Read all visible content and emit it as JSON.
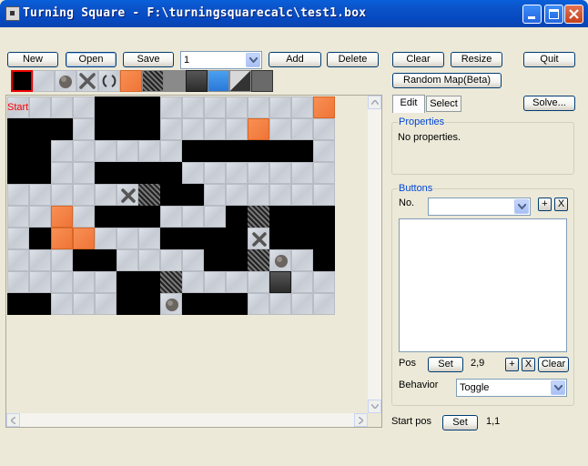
{
  "window": {
    "title": "Turning Square - F:\\turningsquarecalc\\test1.box"
  },
  "toolbar": {
    "new_label": "New",
    "open_label": "Open",
    "save_label": "Save",
    "map_select_value": "1",
    "add_label": "Add",
    "delete_label": "Delete",
    "clear_label": "Clear",
    "resize_label": "Resize",
    "quit_label": "Quit",
    "random_map_label": "Random Map(Beta)",
    "solve_label": "Solve..."
  },
  "palette": [
    {
      "icon": "wall-tile-icon",
      "selected": true
    },
    {
      "icon": "floor-tile-icon"
    },
    {
      "icon": "ball-icon"
    },
    {
      "icon": "x-cross-icon"
    },
    {
      "icon": "rotate-icon"
    },
    {
      "icon": "orange-tile-icon"
    },
    {
      "icon": "hatched-tile-icon"
    },
    {
      "icon": "gray-tile-icon"
    },
    {
      "icon": "dark-tile-icon"
    },
    {
      "icon": "blue-tile-icon"
    },
    {
      "icon": "triangle-tile-icon"
    },
    {
      "icon": "dark-gray-tile-icon"
    }
  ],
  "map": {
    "start_label": "Start",
    "legend": {
      "F": "floor",
      "W": "wall",
      "O": "orange",
      "H": "hatched",
      "D": "dark",
      "X": "x-mark",
      "B": "ball"
    },
    "rows": [
      "FFFFWWWFFFFFFFO",
      "WWWFWWWFFFFOFFF",
      "WWFFFFFFWWWWWWF",
      "WWFFWWWWFFFFFFF",
      "FFFFFXHWWFFFFFF",
      "FFOFWWWFFFWHWWW",
      "FWOOFFFWWWWXWWW",
      "FFFWWFFFFWWHBFW",
      "FFFFFWWHFFFFDFF",
      "WWFFFWWBWWWFFFF"
    ]
  },
  "panel": {
    "tab_edit": "Edit",
    "tab_select": "Select",
    "properties_title": "Properties",
    "properties_text": "No properties.",
    "buttons_title": "Buttons",
    "no_label": "No.",
    "no_select_value": "",
    "plus_label": "+",
    "x_label": "X",
    "pos_label": "Pos",
    "set_label": "Set",
    "pos_value": "2,9",
    "clear_label": "Clear",
    "behavior_label": "Behavior",
    "behavior_value": "Toggle",
    "start_pos_label": "Start pos",
    "start_pos_value": "1,1"
  },
  "colors": {
    "titlebar": "#0a5fd8",
    "wall": "#000000",
    "floor": "#cfd3da",
    "orange": "#f08040",
    "group_title": "#0046d5",
    "start_text": "#ff0000"
  }
}
